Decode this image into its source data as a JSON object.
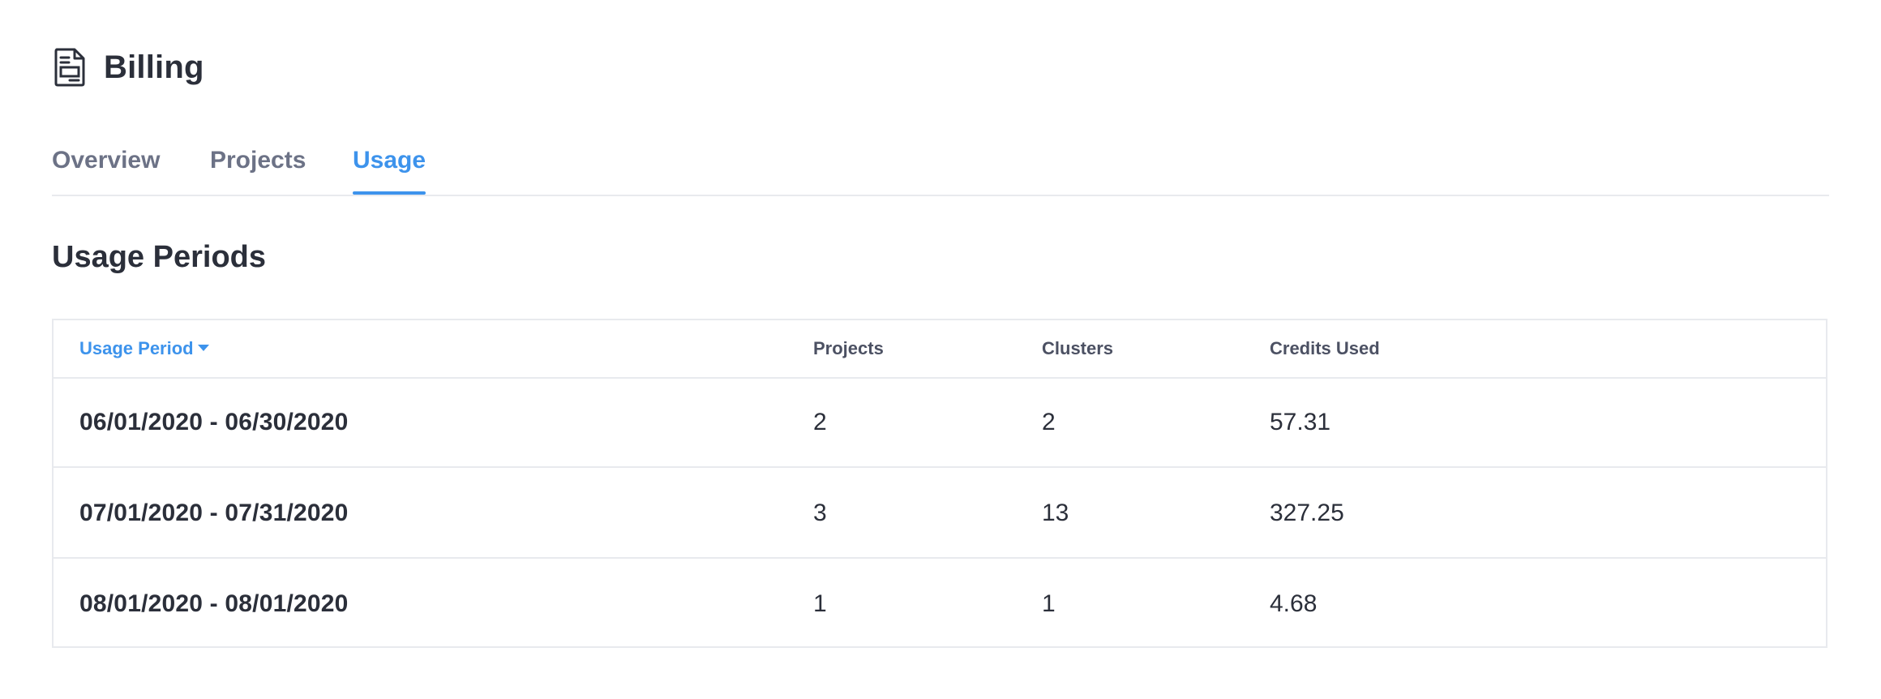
{
  "header": {
    "title": "Billing",
    "icon": "billing-document-icon"
  },
  "tabs": [
    {
      "label": "Overview",
      "active": false
    },
    {
      "label": "Projects",
      "active": false
    },
    {
      "label": "Usage",
      "active": true
    }
  ],
  "colors": {
    "accent": "#3d93ec",
    "text": "#2b2f3a",
    "muted": "#6c7286",
    "border": "#e8eaee"
  },
  "usage": {
    "section_title": "Usage Periods",
    "columns": {
      "period": "Usage Period",
      "projects": "Projects",
      "clusters": "Clusters",
      "credits": "Credits Used"
    },
    "sort": {
      "column": "period",
      "direction": "desc",
      "icon": "caret-down-icon"
    },
    "rows": [
      {
        "period": "06/01/2020 - 06/30/2020",
        "projects": "2",
        "clusters": "2",
        "credits": "57.31"
      },
      {
        "period": "07/01/2020 - 07/31/2020",
        "projects": "3",
        "clusters": "13",
        "credits": "327.25"
      },
      {
        "period": "08/01/2020 - 08/01/2020",
        "projects": "1",
        "clusters": "1",
        "credits": "4.68"
      }
    ]
  }
}
